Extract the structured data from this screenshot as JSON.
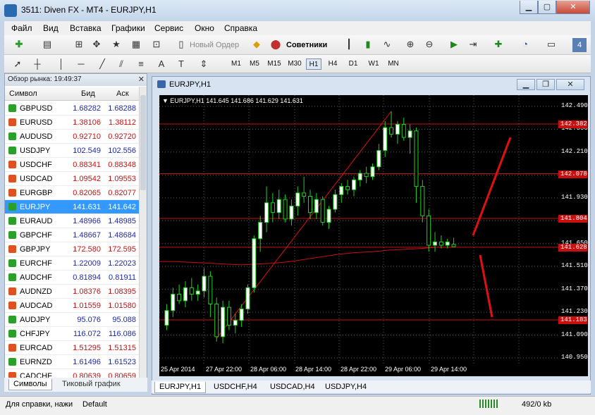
{
  "window": {
    "title": "3511: Diven FX - MT4 - EURJPY,H1"
  },
  "menu": [
    "Файл",
    "Вид",
    "Вставка",
    "Графики",
    "Сервис",
    "Окно",
    "Справка"
  ],
  "toolbar": {
    "new_order": "Новый Ордер",
    "advisors": "Советники",
    "badge": "4"
  },
  "timeframes": [
    "M1",
    "M5",
    "M15",
    "M30",
    "H1",
    "H4",
    "D1",
    "W1",
    "MN"
  ],
  "active_timeframe": "H1",
  "market_watch": {
    "title": "Обзор рынка: 19:49:37",
    "headers": {
      "symbol": "Символ",
      "bid": "Бид",
      "ask": "Аск"
    },
    "rows": [
      {
        "symbol": "GBPUSD",
        "bid": "1.68282",
        "ask": "1.68288",
        "dir": "up",
        "color": "#1f2aa8"
      },
      {
        "symbol": "EURUSD",
        "bid": "1.38106",
        "ask": "1.38112",
        "dir": "down",
        "color": "#c81010"
      },
      {
        "symbol": "AUDUSD",
        "bid": "0.92710",
        "ask": "0.92720",
        "dir": "up",
        "color": "#c81010"
      },
      {
        "symbol": "USDJPY",
        "bid": "102.549",
        "ask": "102.556",
        "dir": "up",
        "color": "#1f2aa8"
      },
      {
        "symbol": "USDCHF",
        "bid": "0.88341",
        "ask": "0.88348",
        "dir": "down",
        "color": "#c81010"
      },
      {
        "symbol": "USDCAD",
        "bid": "1.09542",
        "ask": "1.09553",
        "dir": "down",
        "color": "#c81010"
      },
      {
        "symbol": "EURGBP",
        "bid": "0.82065",
        "ask": "0.82077",
        "dir": "down",
        "color": "#c81010"
      },
      {
        "symbol": "EURJPY",
        "bid": "141.631",
        "ask": "141.642",
        "dir": "up",
        "color": "#ffffff"
      },
      {
        "symbol": "EURAUD",
        "bid": "1.48966",
        "ask": "1.48985",
        "dir": "up",
        "color": "#1f2aa8"
      },
      {
        "symbol": "GBPCHF",
        "bid": "1.48667",
        "ask": "1.48684",
        "dir": "up",
        "color": "#1f2aa8"
      },
      {
        "symbol": "GBPJPY",
        "bid": "172.580",
        "ask": "172.595",
        "dir": "down",
        "color": "#c81010"
      },
      {
        "symbol": "EURCHF",
        "bid": "1.22009",
        "ask": "1.22023",
        "dir": "up",
        "color": "#1f2aa8"
      },
      {
        "symbol": "AUDCHF",
        "bid": "0.81894",
        "ask": "0.81911",
        "dir": "up",
        "color": "#1f2aa8"
      },
      {
        "symbol": "AUDNZD",
        "bid": "1.08376",
        "ask": "1.08395",
        "dir": "down",
        "color": "#c81010"
      },
      {
        "symbol": "AUDCAD",
        "bid": "1.01559",
        "ask": "1.01580",
        "dir": "down",
        "color": "#c81010"
      },
      {
        "symbol": "AUDJPY",
        "bid": "95.076",
        "ask": "95.088",
        "dir": "up",
        "color": "#1f2aa8"
      },
      {
        "symbol": "CHFJPY",
        "bid": "116.072",
        "ask": "116.086",
        "dir": "up",
        "color": "#1f2aa8"
      },
      {
        "symbol": "EURCAD",
        "bid": "1.51295",
        "ask": "1.51315",
        "dir": "down",
        "color": "#c81010"
      },
      {
        "symbol": "EURNZD",
        "bid": "1.61496",
        "ask": "1.61523",
        "dir": "up",
        "color": "#1f2aa8"
      },
      {
        "symbol": "CADCHF",
        "bid": "0.80639",
        "ask": "0.80659",
        "dir": "down",
        "color": "#c81010"
      }
    ],
    "tabs": [
      "Символы",
      "Тиковый график"
    ]
  },
  "chart_window": {
    "title": "EURJPY,H1",
    "info": "▼ EURJPY,H1  141.645 141.686 141.629 141.631",
    "tabs": [
      "EURJPY,H1",
      "USDCHF,H4",
      "USDCAD,H4",
      "USDJPY,H4"
    ]
  },
  "chart_data": {
    "type": "candlestick",
    "symbol": "EURJPY",
    "timeframe": "H1",
    "price_ticks": [
      "142.490",
      "142.350",
      "142.210",
      "142.070",
      "141.930",
      "141.790",
      "141.650",
      "141.510",
      "141.370",
      "141.230",
      "141.090",
      "140.950"
    ],
    "ylim": [
      140.95,
      142.49
    ],
    "time_ticks": [
      "25 Apr 2014",
      "27 Apr 22:00",
      "28 Apr 06:00",
      "28 Apr 14:00",
      "28 Apr 22:00",
      "29 Apr 06:00",
      "29 Apr 14:00"
    ],
    "horizontal_levels": [
      {
        "price": 142.382,
        "label": "142.382"
      },
      {
        "price": 142.078,
        "label": "142.078"
      },
      {
        "price": 141.804,
        "label": "141.804"
      },
      {
        "price": 141.628,
        "label": "141.628"
      },
      {
        "price": 141.183,
        "label": "141.183"
      }
    ],
    "candles": [
      [
        141.15,
        141.28,
        141.12,
        141.24
      ],
      [
        141.24,
        141.38,
        141.2,
        141.34
      ],
      [
        141.34,
        141.4,
        141.28,
        141.3
      ],
      [
        141.3,
        141.42,
        141.26,
        141.38
      ],
      [
        141.38,
        141.44,
        141.3,
        141.34
      ],
      [
        141.34,
        141.4,
        141.3,
        141.36
      ],
      [
        141.36,
        141.5,
        141.32,
        141.45
      ],
      [
        141.45,
        141.48,
        141.2,
        141.28
      ],
      [
        141.28,
        141.32,
        141.05,
        141.08
      ],
      [
        141.08,
        141.3,
        141.04,
        141.26
      ],
      [
        141.26,
        141.3,
        141.12,
        141.15
      ],
      [
        141.15,
        141.22,
        141.1,
        141.18
      ],
      [
        141.18,
        141.28,
        141.14,
        141.25
      ],
      [
        141.25,
        141.4,
        141.22,
        141.38
      ],
      [
        141.38,
        141.7,
        141.35,
        141.68
      ],
      [
        141.68,
        141.82,
        141.6,
        141.78
      ],
      [
        141.78,
        142.0,
        141.72,
        141.9
      ],
      [
        141.9,
        141.96,
        141.78,
        141.84
      ],
      [
        141.84,
        141.98,
        141.8,
        141.92
      ],
      [
        141.92,
        141.95,
        141.78,
        141.8
      ],
      [
        141.8,
        141.92,
        141.76,
        141.88
      ],
      [
        141.88,
        142.0,
        141.82,
        141.96
      ],
      [
        141.96,
        142.06,
        141.9,
        141.94
      ],
      [
        141.94,
        141.98,
        141.8,
        141.84
      ],
      [
        141.84,
        141.96,
        141.8,
        141.92
      ],
      [
        141.92,
        141.94,
        141.76,
        141.78
      ],
      [
        141.78,
        141.88,
        141.74,
        141.86
      ],
      [
        141.86,
        141.98,
        141.84,
        141.95
      ],
      [
        141.95,
        142.02,
        141.9,
        142.0
      ],
      [
        142.0,
        142.04,
        141.95,
        141.98
      ],
      [
        141.98,
        142.06,
        141.94,
        142.04
      ],
      [
        142.04,
        142.1,
        142.0,
        142.08
      ],
      [
        142.08,
        142.12,
        142.02,
        142.06
      ],
      [
        142.06,
        142.14,
        142.04,
        142.12
      ],
      [
        142.12,
        142.26,
        142.1,
        142.22
      ],
      [
        142.22,
        142.4,
        142.18,
        142.36
      ],
      [
        142.36,
        142.46,
        142.3,
        142.32
      ],
      [
        142.32,
        142.4,
        142.26,
        142.38
      ],
      [
        142.38,
        142.42,
        142.28,
        142.3
      ],
      [
        142.3,
        142.38,
        142.2,
        142.34
      ],
      [
        142.34,
        142.36,
        141.9,
        142.0
      ],
      [
        142.0,
        142.04,
        141.78,
        141.82
      ],
      [
        141.82,
        141.86,
        141.6,
        141.64
      ],
      [
        141.64,
        141.72,
        141.6,
        141.66
      ],
      [
        141.66,
        141.7,
        141.62,
        141.64
      ],
      [
        141.64,
        141.68,
        141.62,
        141.66
      ],
      [
        141.645,
        141.686,
        141.629,
        141.631
      ]
    ],
    "ma_line": [
      141.54,
      141.54,
      141.535,
      141.53,
      141.525,
      141.52,
      141.525,
      141.53,
      141.54,
      141.555,
      141.57,
      141.585,
      141.595,
      141.6,
      141.61,
      141.615,
      141.62,
      141.628,
      141.628
    ],
    "trendline": [
      [
        8,
        141.07
      ],
      [
        36,
        142.46
      ]
    ],
    "annotations": [
      {
        "from": [
          141.7,
          0
        ],
        "to": [
          142.3,
          0
        ]
      },
      {
        "from": [
          141.58,
          0
        ],
        "to": [
          141.2,
          0
        ]
      }
    ]
  },
  "status": {
    "help": "Для справки, нажи",
    "profile": "Default",
    "traffic": "492/0 kb"
  },
  "colors": {
    "up_arrow": "#2aa02a",
    "down_arrow": "#e05020",
    "level": "#c81010",
    "grid": "#5a5a5a",
    "candle_bull": "#ffffff",
    "candle_bear": "#000000"
  }
}
